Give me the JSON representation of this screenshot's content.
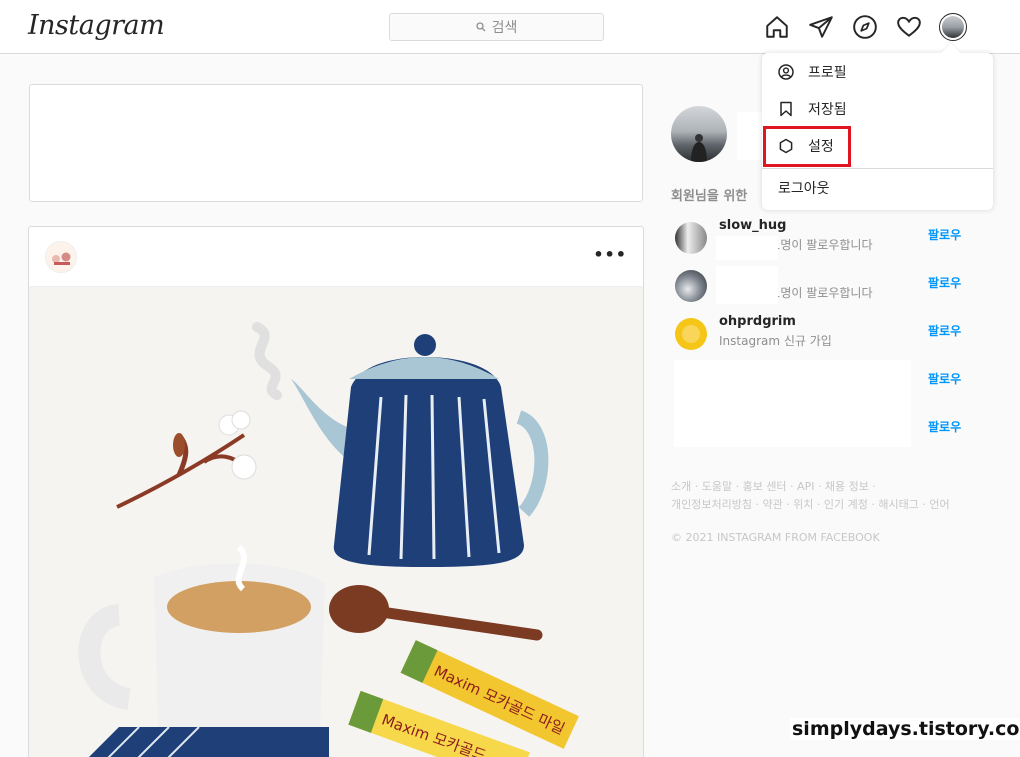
{
  "header": {
    "logo": "Instagram",
    "search_placeholder": "검색"
  },
  "dropdown": {
    "items": [
      {
        "label": "프로필",
        "icon": "profile-icon"
      },
      {
        "label": "저장됨",
        "icon": "bookmark-icon"
      },
      {
        "label": "설정",
        "icon": "settings-gear-icon"
      }
    ],
    "logout": "로그아웃"
  },
  "sidebar": {
    "suggestions_title": "회원님을 위한",
    "suggestions": [
      {
        "username": "slow_hug",
        "subtitle": "님 외 1명이 팔로우합니다",
        "follow": "팔로우"
      },
      {
        "username": "",
        "subtitle": "님 외 1명이 팔로우합니다",
        "follow": "팔로우"
      },
      {
        "username": "ohprdgrim",
        "subtitle": "Instagram 신규 가입",
        "follow": "팔로우"
      },
      {
        "username": "",
        "subtitle": "",
        "follow": "팔로우"
      },
      {
        "username": "",
        "subtitle": "",
        "follow": "팔로우"
      }
    ],
    "footer_line1": "소개 · 도움말 · 홍보 센터 · API · 채용 정보 ·",
    "footer_line2": "개인정보처리방침 · 약관 · 위치 · 인기 계정 · 해시태그 · 언어",
    "copyright": "© 2021 INSTAGRAM FROM FACEBOOK"
  },
  "post": {
    "more": "•••",
    "stick1": "Maxim 모카골드 마일",
    "stick2": "Maxim 모카골드"
  },
  "watermark": "simplydays.tistory.com",
  "colors": {
    "accent": "#0095f6",
    "highlight": "#e0151f",
    "teapot": "#1f3f78"
  }
}
